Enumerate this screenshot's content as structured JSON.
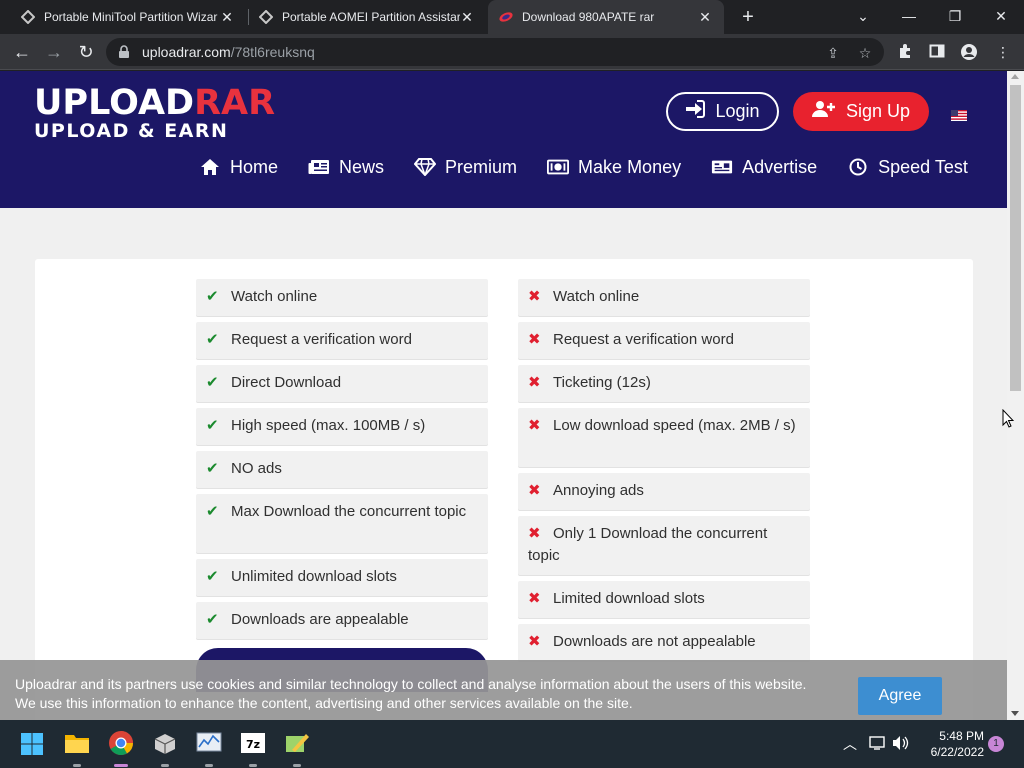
{
  "browser": {
    "tabs": [
      {
        "title": "Portable MiniTool Partition Wizar",
        "active": false
      },
      {
        "title": "Portable AOMEI Partition Assistar",
        "active": false
      },
      {
        "title": "Download 980APATE rar",
        "active": true
      }
    ],
    "url_host": "uploadrar.com",
    "url_path": "/78tl6reuksnq"
  },
  "site": {
    "logo_top_white": "UPL",
    "logo_top_o": "O",
    "logo_top_ad": "AD",
    "logo_top_red": "RAR",
    "logo_bottom": "UPLOAD & EARN",
    "login_label": "Login",
    "signup_label": "Sign Up",
    "nav": [
      {
        "label": "Home",
        "icon": "home-icon"
      },
      {
        "label": "News",
        "icon": "newspaper-icon"
      },
      {
        "label": "Premium",
        "icon": "diamond-icon"
      },
      {
        "label": "Make Money",
        "icon": "money-icon"
      },
      {
        "label": "Advertise",
        "icon": "ad-card-icon"
      },
      {
        "label": "Speed Test",
        "icon": "clock-icon"
      }
    ],
    "colors": {
      "header_bg": "#1c1766",
      "accent_red": "#e8222e",
      "check_green": "#1b8a2e",
      "cross_red": "#e02030"
    }
  },
  "comparison": {
    "premium": [
      "Watch online",
      "Request a verification word",
      "Direct Download",
      "High speed (max. 100MB / s)",
      "NO ads",
      "Max Download the concurrent topic",
      "Unlimited download slots",
      "Downloads are appealable"
    ],
    "free": [
      "Watch online",
      "Request a verification word",
      "Ticketing (12s)",
      "Low download speed (max. 2MB / s)",
      "Annoying ads",
      "Only 1 Download the concurrent topic",
      "Limited download slots",
      "Downloads are not appealable"
    ]
  },
  "cookie_banner": {
    "line1": "Uploadrar and its partners use cookies and similar technology to collect and analyse information about the users of this website.",
    "line2": "We use this information to enhance the content, advertising and other services available on the site.",
    "agree_label": "Agree"
  },
  "taskbar": {
    "time": "5:48 PM",
    "date": "6/22/2022",
    "notification_count": "1"
  }
}
